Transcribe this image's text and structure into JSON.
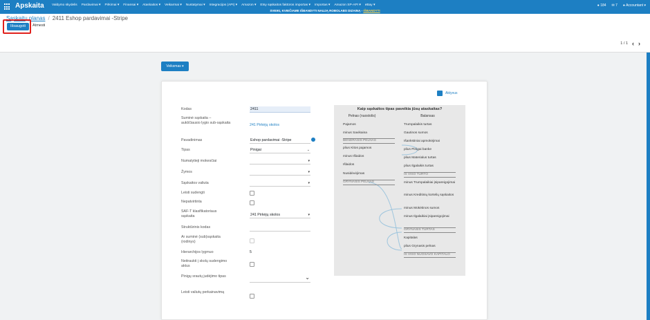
{
  "topbar": {
    "brand": "Apskaita",
    "menu": [
      "Valdymo skydelis",
      "Pardavimai ▾",
      "Pirkimai ▾",
      "Finansai ▾",
      "Ataskaitos ▾",
      "Veikarmai ▾",
      "Nustatymai ▾",
      "Integracijos (API) ▾",
      "Amazon ▾",
      "Etsy sąskaitos faktūros importas ▾",
      "Importas ▾",
      "Amazon SP-API ▾",
      "eBay ▾"
    ],
    "banner_text": "SVEIKI, KVIEČIAME IŠBANDYTI NAUJĄ ROBOLABS DIZAINĄ -",
    "banner_link": "IŠBANDYTI",
    "activity_count": "184",
    "message_count": "7",
    "user": "Accountant ▾"
  },
  "breadcrumb": {
    "parent": "Sąskaitų planas",
    "current": "2411 Eshop pardavimai -Stripe"
  },
  "buttons": {
    "save": "Išsaugoti",
    "discard": "Atmesti",
    "actions": "Veiksmas ▾"
  },
  "pager": {
    "value": "1 / 1"
  },
  "status": {
    "label": "Aktyvus"
  },
  "form": {
    "code_label": "Kodas",
    "code_value": "2411",
    "parent_label": "Suminė sąskaita – aukščiausio lygio sub-sąskaita",
    "parent_value": "241 Pirkėjų skolos",
    "name_label": "Pavadinimas",
    "name_value": "Eshop pardavimai -Stripe",
    "type_label": "Tipas",
    "type_value": "Pinigai",
    "taxes_label": "Numatytieji mokesčiai",
    "tags_label": "Žymos",
    "currency_label": "Sąskaitos valiuta",
    "reconcile_label": "Leisti sudengti",
    "deprecated_label": "Nepatvirtinta",
    "saft_label": "SAF-T klasifikatoriaus sąskaita",
    "saft_value": "241 Pirkėjų skolos",
    "structural_label": "Struktūrinis kodas",
    "summary_label": "Ar suminė (sub)sąskaita (rodinys)",
    "hierarchy_label": "Hierarchijos lygmuo",
    "hierarchy_value": "5",
    "exclude_label": "Neitraukti į skolų sudengimo aktus",
    "cashflow_label": "Pinigų srautų judėjimo tipas",
    "revaluation_label": "Leisti valiutų perkainavimą"
  },
  "help": {
    "title": "Kaip sąskaitos tipas paveikia jūsų ataskaitas?",
    "left_head": "Pelnas (nuostolis)",
    "right_head": "Balansas",
    "left": [
      "Pajamos",
      "minus Savikaina",
      "BENDRASIS PELNAS",
      "plius Kitos pajamos",
      "minus Išlaidos",
      "Išlaidos",
      "Nusidėvėjimas",
      "GRYNASIS PELNAS"
    ],
    "right": [
      "Trumpalaikis turtas",
      "Gautinos sumos",
      "Išankstiniai apmokėjimai",
      "plius Pinigai banke",
      "plius Materialus turtas",
      "plius Ilgalaikis turtas",
      "IŠ VISO TURTO",
      "minus Trumpalaikiai įsipareigojimai",
      "minus Kreditinių kortelių sąskaitos",
      "minus Mokėtinos sumos",
      "minus Ilgalaikiai įsipareigojimai",
      "GRYNASIS TURTAS",
      "Kapitalas",
      "plius Grynasis pelnas",
      "IŠ VISO NUOSAVO KAPITALO"
    ]
  },
  "colors": {
    "primary": "#1d7fc3",
    "highlight": "#e0201c",
    "banner_link": "#ffd54f"
  }
}
